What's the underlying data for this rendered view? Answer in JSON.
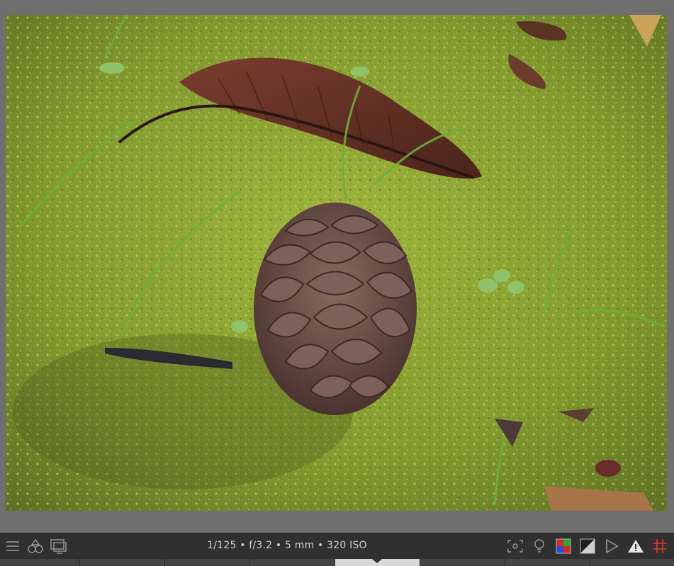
{
  "exif": {
    "text": "1/125 • f/3.2 • 5 mm • 320 ISO"
  },
  "icons": {
    "left": [
      "hamburger-icon",
      "shapes-icon",
      "display-icon"
    ],
    "right": [
      "focus-frame-icon",
      "lightbulb-icon",
      "color-squares-icon",
      "contrast-icon",
      "play-outline-icon",
      "warning-icon",
      "grid-icon"
    ]
  },
  "colors": {
    "toolbar_bg": "#303030",
    "canvas_bg": "#6f6f6f",
    "grid_icon": "#e23a2a",
    "warning_icon": "#e6e6e6"
  },
  "filmstrip": {
    "segments": 8,
    "active_index": 4
  }
}
